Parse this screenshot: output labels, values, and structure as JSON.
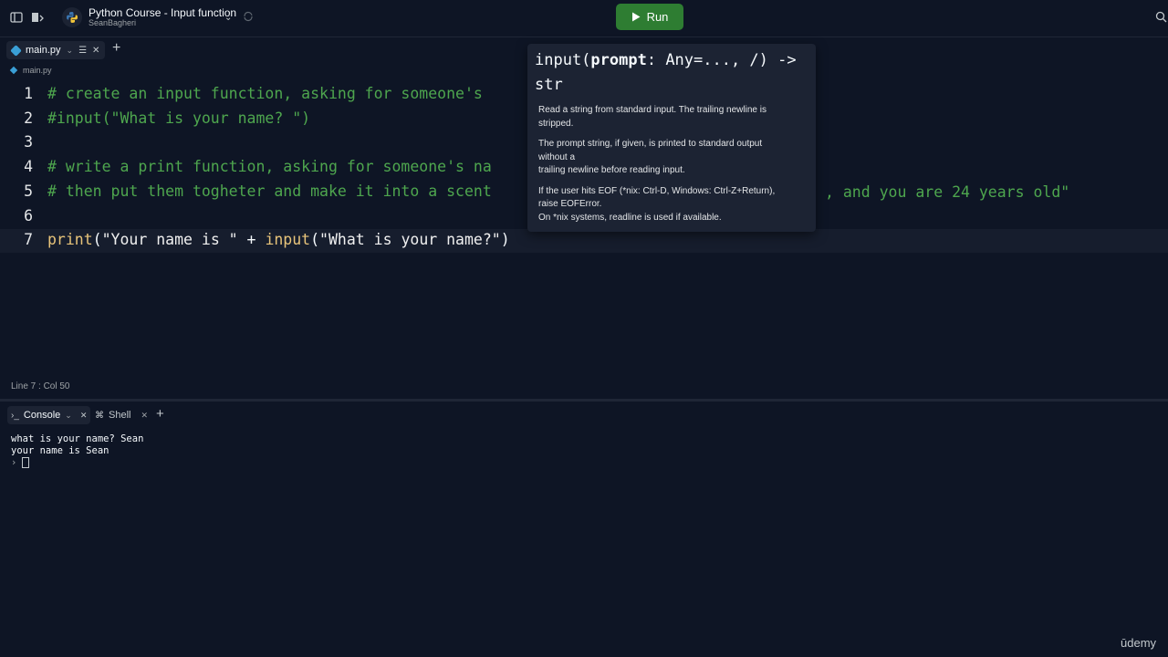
{
  "topbar": {
    "project_title": "Python Course - Input function",
    "project_owner": "SeanBagheri",
    "run_label": "Run",
    "icons": [
      "sidebar-toggle-icon",
      "layout-icon",
      "python-logo-icon",
      "chevron-down-icon",
      "sync-icon",
      "search-icon"
    ]
  },
  "tabs": {
    "file_tab_label": "main.py",
    "new_tab_label": "+"
  },
  "breadcrumb": "main.py",
  "editor": {
    "lines": [
      {
        "num": "1",
        "parts": [
          {
            "c": "cm",
            "t": "# create an input function, asking for someone's "
          }
        ]
      },
      {
        "num": "2",
        "parts": [
          {
            "c": "cm",
            "t": "#input(\"What is your name? \")"
          }
        ]
      },
      {
        "num": "3",
        "parts": []
      },
      {
        "num": "4",
        "parts": [
          {
            "c": "cm",
            "t": "# write a print function, asking for someone's na"
          }
        ]
      },
      {
        "num": "5",
        "parts": [
          {
            "c": "cm",
            "t": "# then put them togheter and make it into a scent"
          }
        ]
      },
      {
        "num": "6",
        "parts": []
      },
      {
        "num": "7",
        "parts": [
          {
            "c": "fn",
            "t": "print"
          },
          {
            "c": "pl",
            "t": "("
          },
          {
            "c": "str",
            "t": "\"Your name is \""
          },
          {
            "c": "pl",
            "t": " + "
          },
          {
            "c": "fn",
            "t": "input"
          },
          {
            "c": "pl",
            "t": "("
          },
          {
            "c": "str",
            "t": "\"What is your name?\""
          },
          {
            "c": "pl",
            "t": ")"
          }
        ]
      }
    ],
    "line5_tail": ", and you are 24 years old\""
  },
  "status": "Line 7 : Col 50",
  "console_tabs": {
    "console_label": "Console",
    "shell_label": "Shell",
    "new_tab_label": "+"
  },
  "console": {
    "line1": "what is your name? Sean",
    "line2": "your name is Sean",
    "prompt": "›"
  },
  "tooltip": {
    "sig_name": "input(",
    "sig_param": "prompt",
    "sig_rest": ": Any=..., /) ->",
    "sig_return": "str",
    "p1": "Read a string from standard input.  The trailing newline is\nstripped.",
    "p2": "The prompt string, if given, is printed to standard output\nwithout a\ntrailing newline before reading input.",
    "p3": "If the user hits EOF (*nix: Ctrl-D, Windows: Ctrl-Z+Return),\nraise EOFError.\nOn *nix systems, readline is used if available."
  },
  "watermark": "ūdemy",
  "colors": {
    "background": "#0e1525",
    "run_button": "#2e7d32",
    "comment": "#4ea64e",
    "function": "#e8c47a",
    "tooltip_bg": "#1c2333"
  }
}
